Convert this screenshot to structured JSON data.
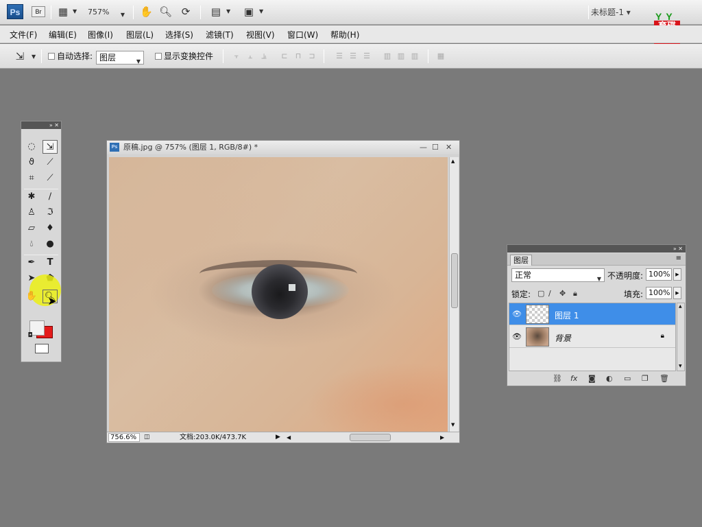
{
  "appbar": {
    "logo": "Ps",
    "bridge": "Br",
    "zoom": "757%",
    "doc_title": "未标题-1"
  },
  "brand": {
    "top": "YY",
    "line1": "育碟",
    "line2": "教育"
  },
  "menu": [
    "文件(F)",
    "编辑(E)",
    "图像(I)",
    "图层(L)",
    "选择(S)",
    "滤镜(T)",
    "视图(V)",
    "窗口(W)",
    "帮助(H)"
  ],
  "options": {
    "auto_select_label": "自动选择:",
    "auto_select_value": "图层",
    "show_transform_label": "显示变换控件"
  },
  "document": {
    "title": "原稿.jpg @ 757% (图层 1, RGB/8#) *",
    "zoom_status": "756.6%",
    "doc_size": "文档:203.0K/473.7K"
  },
  "layers_panel": {
    "tab": "图层",
    "blend_mode": "正常",
    "opacity_label": "不透明度:",
    "opacity": "100%",
    "lock_label": "锁定:",
    "fill_label": "填充:",
    "fill": "100%",
    "layers": [
      {
        "name": "图层 1",
        "selected": true
      },
      {
        "name": "背景",
        "selected": false,
        "locked": true
      }
    ]
  },
  "colors": {
    "accent_selection": "#3f8ee8",
    "foreground": "#f3f3f3",
    "background": "#e41b1b"
  }
}
